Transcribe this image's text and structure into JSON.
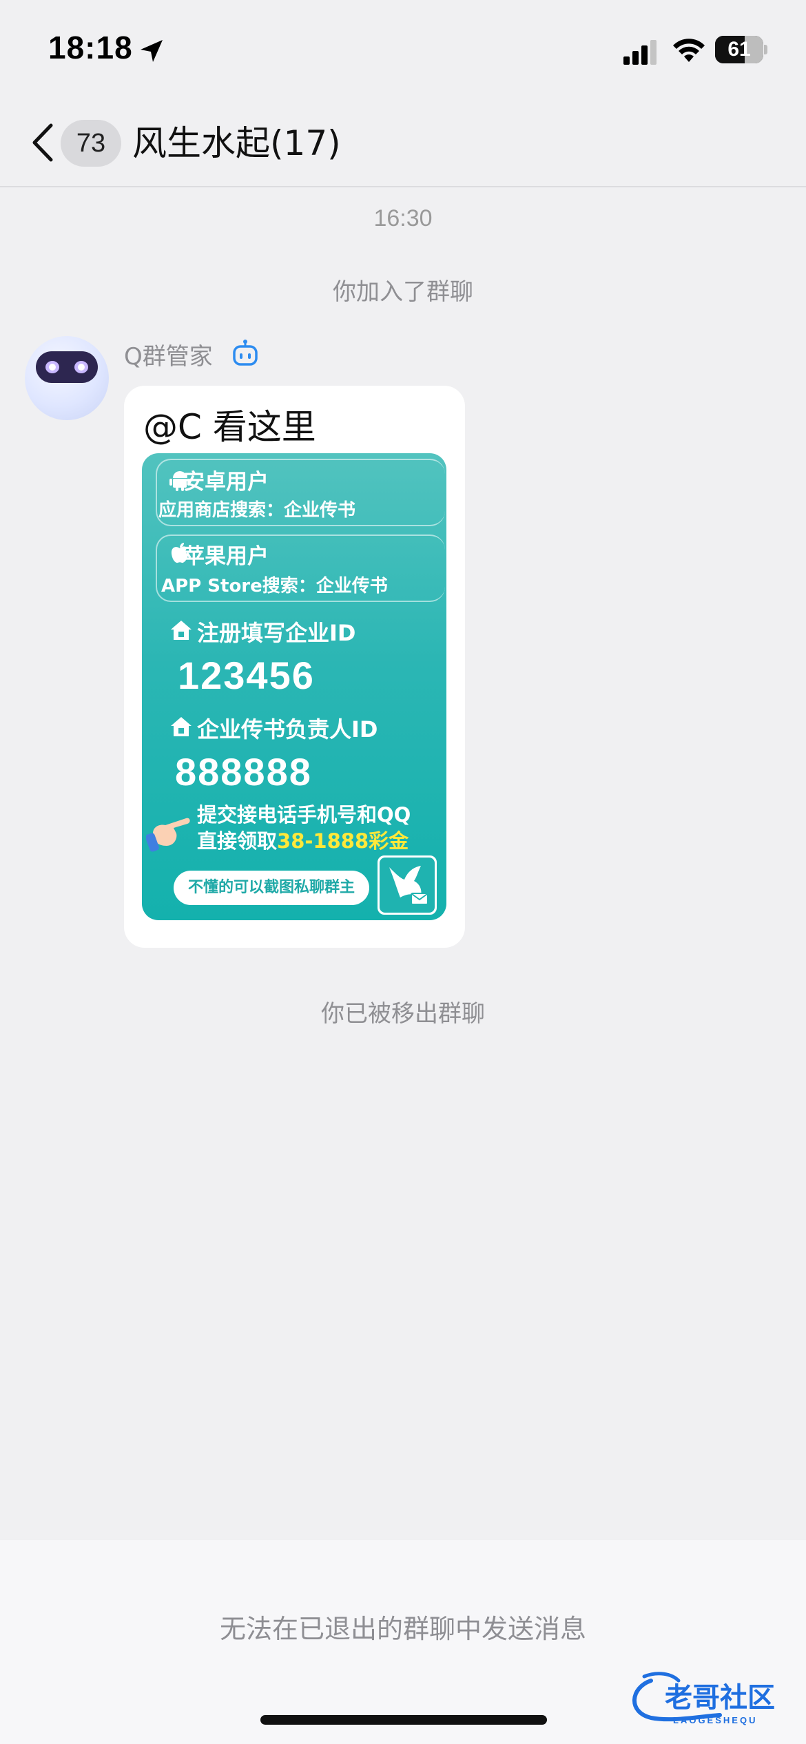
{
  "status_bar": {
    "time": "18:18",
    "battery": "61",
    "battery_level_percent": 61,
    "icons": [
      "location-arrow-icon",
      "cellular-signal-icon",
      "wifi-icon",
      "battery-icon"
    ]
  },
  "nav": {
    "back_icon": "chevron-left-icon",
    "unread_count": "73",
    "title": "风生水起(17)"
  },
  "chat": {
    "timestamp": "16:30",
    "system_joined": "你加入了群聊",
    "message": {
      "sender": "Q群管家",
      "sender_badge_icon": "robot-icon",
      "text": "@C 看这里",
      "ad": {
        "android_title": "安卓用户",
        "android_sub": "应用商店搜索：企业传书",
        "apple_title": "苹果用户",
        "apple_sub": "APP Store搜索：企业传书",
        "company_label": "注册填写企业ID",
        "company_id": "123456",
        "manager_label": "企业传书负责人ID",
        "manager_id": "888888",
        "cta_line1": "提交接电话手机号和QQ",
        "cta_line2_prefix": "直接领取",
        "cta_highlight": "38-1888彩金",
        "pill": "不懂的可以截图私聊群主"
      }
    },
    "system_removed": "你已被移出群聊"
  },
  "bottom": {
    "notice": "无法在已退出的群聊中发送消息"
  },
  "watermark": {
    "text": "老哥社区",
    "sub": "LAOGESHEQU"
  },
  "colors": {
    "background": "#f0f0f2",
    "card_teal": "#2bb6b4",
    "highlight_yellow": "#ffe83a",
    "bot_icon_blue": "#2d8cf0",
    "watermark_blue": "#1f6fe0"
  }
}
